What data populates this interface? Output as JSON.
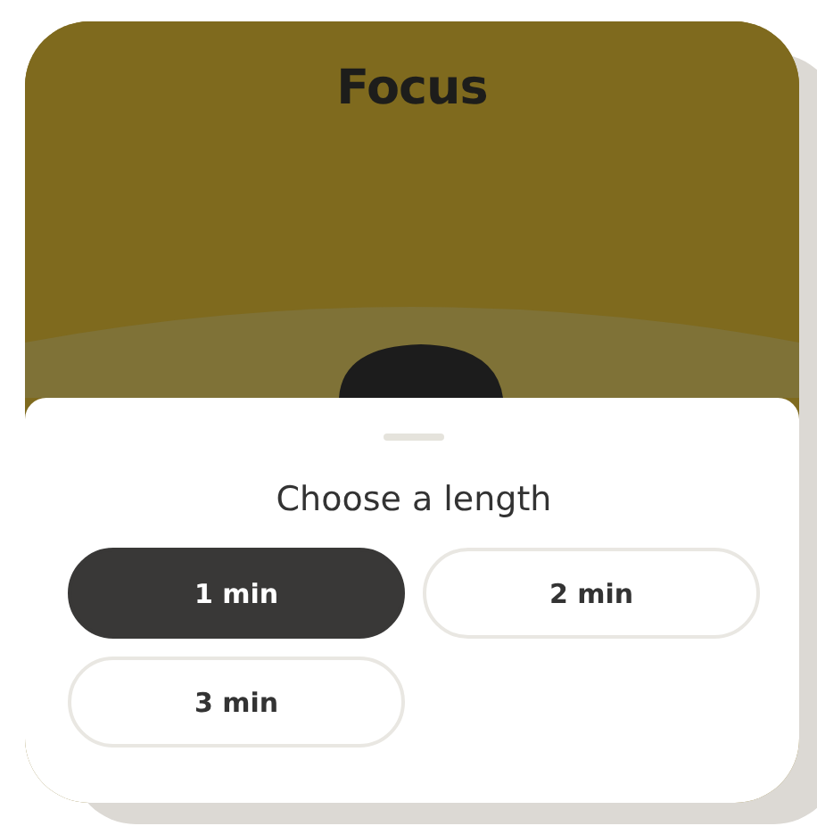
{
  "header": {
    "title": "Focus"
  },
  "sheet": {
    "title": "Choose a length",
    "options": [
      {
        "label": "1 min",
        "selected": true
      },
      {
        "label": "2 min",
        "selected": false
      },
      {
        "label": "3 min",
        "selected": false
      }
    ]
  }
}
